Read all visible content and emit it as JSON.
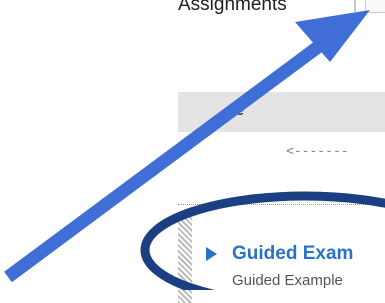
{
  "tabbar": {
    "label": "Assignments"
  },
  "list": {
    "header_label": "e",
    "drag_hint": "<-------",
    "item": {
      "title": "Guided Exam",
      "subtitle": "Guided Example"
    }
  },
  "annotations": {
    "arrow_color": "#3f6ed6",
    "ellipse_color": "#1c3f82"
  }
}
